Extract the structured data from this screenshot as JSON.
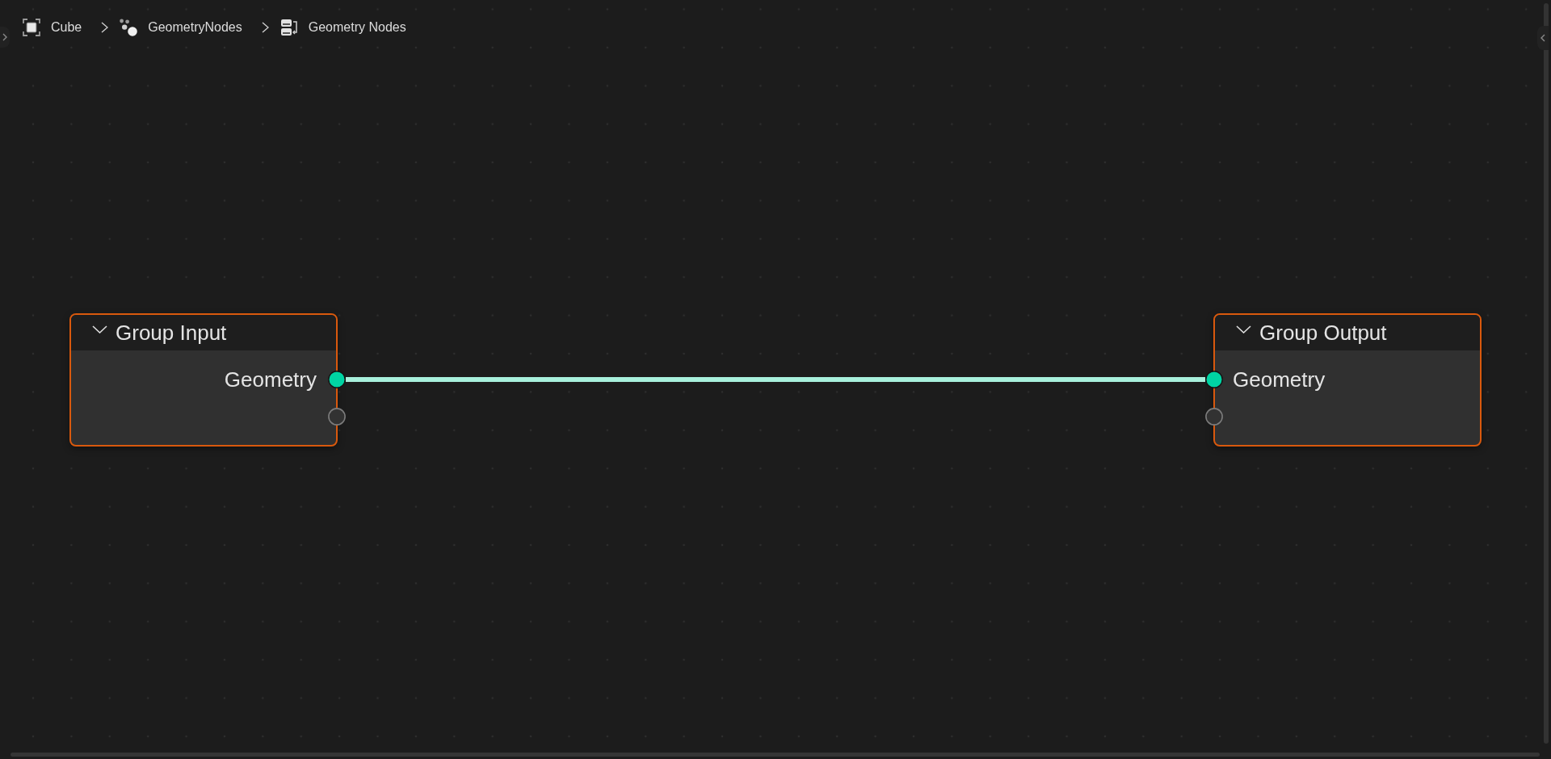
{
  "breadcrumb": [
    {
      "label": "Cube",
      "kind": "object"
    },
    {
      "label": "GeometryNodes",
      "kind": "modifier"
    },
    {
      "label": "Geometry Nodes",
      "kind": "node_tree"
    }
  ],
  "nodes": [
    {
      "title": "Group Input",
      "kind": "group_input",
      "selected": true,
      "expanded": true,
      "sockets": [
        {
          "label": "Geometry",
          "kind": "geometry",
          "connected": true
        },
        {
          "kind": "virtual",
          "connected": false
        }
      ]
    },
    {
      "title": "Group Output",
      "kind": "group_output",
      "selected": true,
      "expanded": true,
      "sockets": [
        {
          "label": "Geometry",
          "kind": "geometry",
          "connected": true
        },
        {
          "kind": "virtual",
          "connected": false
        }
      ]
    }
  ]
}
